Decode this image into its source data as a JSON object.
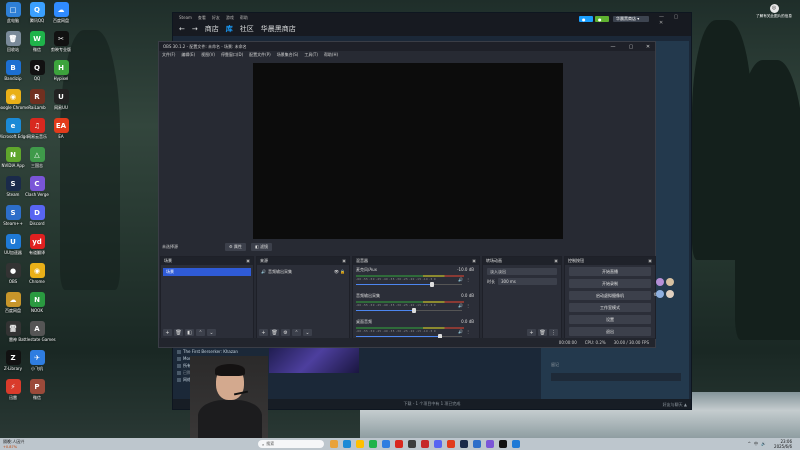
{
  "desktop": {
    "icons": [
      {
        "label": "此电脑",
        "color": "#2e7fd6",
        "glyph": "□"
      },
      {
        "label": "腾讯QQ",
        "color": "#3aa0ff",
        "glyph": "Q"
      },
      {
        "label": "百度网盘",
        "color": "#2f8bff",
        "glyph": "☁"
      },
      {
        "label": "回收站",
        "color": "#7a8a99",
        "glyph": "🗑"
      },
      {
        "label": "微信",
        "color": "#1fb34a",
        "glyph": "W"
      },
      {
        "label": "剪映专业版",
        "color": "#111111",
        "glyph": "✂"
      },
      {
        "label": "Bandizip",
        "color": "#1d6fd1",
        "glyph": "B"
      },
      {
        "label": "QQ",
        "color": "#111111",
        "glyph": "Q"
      },
      {
        "label": "Hypixel",
        "color": "#3ca33c",
        "glyph": "H"
      },
      {
        "label": "Google Chrome",
        "color": "#e9b018",
        "glyph": "◉"
      },
      {
        "label": "RaiLamb",
        "color": "#703020",
        "glyph": "R"
      },
      {
        "label": "网易UU",
        "color": "#222222",
        "glyph": "U"
      },
      {
        "label": "Microsoft Edge",
        "color": "#1b8ad6",
        "glyph": "e"
      },
      {
        "label": "网易云音乐",
        "color": "#d8281f",
        "glyph": "♫"
      },
      {
        "label": "EA",
        "color": "#e23b1b",
        "glyph": "EA"
      },
      {
        "label": "NVIDIA App",
        "color": "#5fa62c",
        "glyph": "N"
      },
      {
        "label": "三国志",
        "color": "#3f9a4a",
        "glyph": "△"
      },
      {
        "label": "",
        "color": "transparent",
        "glyph": ""
      },
      {
        "label": "Steam",
        "color": "#1a2a4a",
        "glyph": "S"
      },
      {
        "label": "Clash Verge",
        "color": "#7a55d8",
        "glyph": "C"
      },
      {
        "label": "",
        "color": "transparent",
        "glyph": ""
      },
      {
        "label": "Steam++",
        "color": "#2d6ec9",
        "glyph": "S"
      },
      {
        "label": "Discord",
        "color": "#5865f2",
        "glyph": "D"
      },
      {
        "label": "",
        "color": "transparent",
        "glyph": ""
      },
      {
        "label": "UU加速器",
        "color": "#1f7ad6",
        "glyph": "U"
      },
      {
        "label": "有道翻译",
        "color": "#e02020",
        "glyph": "yd"
      },
      {
        "label": "",
        "color": "transparent",
        "glyph": ""
      },
      {
        "label": "OBS",
        "color": "#333333",
        "glyph": "●"
      },
      {
        "label": "Chrome",
        "color": "#e9b018",
        "glyph": "◉"
      },
      {
        "label": "",
        "color": "transparent",
        "glyph": ""
      },
      {
        "label": "百度网盘",
        "color": "#c7952a",
        "glyph": "☁"
      },
      {
        "label": "NOOK",
        "color": "#2a9a40",
        "glyph": "N"
      },
      {
        "label": "",
        "color": "transparent",
        "glyph": ""
      },
      {
        "label": "雷神",
        "color": "#333333",
        "glyph": "雷"
      },
      {
        "label": "Battlestate Games",
        "color": "#555555",
        "glyph": "A"
      },
      {
        "label": "",
        "color": "transparent",
        "glyph": ""
      },
      {
        "label": "Z-Library",
        "color": "#111111",
        "glyph": "Z"
      },
      {
        "label": "小飞机",
        "color": "#2f7de0",
        "glyph": "✈"
      },
      {
        "label": "",
        "color": "transparent",
        "glyph": ""
      },
      {
        "label": "迅雷",
        "color": "#d93b2b",
        "glyph": "⚡"
      },
      {
        "label": "微信",
        "color": "#9b4a3a",
        "glyph": "P"
      }
    ]
  },
  "steam": {
    "top_menu": [
      "Steam",
      "查看",
      "好友",
      "游戏",
      "帮助"
    ],
    "nav": {
      "store": "商店",
      "library": "库",
      "community": "社区",
      "user": "华晨黑商店"
    },
    "buttons": [
      {
        "label": "●",
        "color": "#1a9fff"
      },
      {
        "label": "●",
        "color": "#5fb130"
      }
    ],
    "user": "华晨黑商店 ▾",
    "library_list": [
      {
        "label": "全部",
        "color": "#8f98a0"
      },
      {
        "label": "The First Berserker: Khazan",
        "color": "#c6d4df"
      },
      {
        "label": "Monster Hunter Wilds",
        "color": "#c6d4df"
      },
      {
        "label": "所有游戏",
        "color": "#c6d4df"
      },
      {
        "label": "已购",
        "color": "#8f98a0"
      },
      {
        "label": "网络浏览",
        "color": "#c6d4df"
      }
    ],
    "downloads": "下载 - 1 个项目中有 1 项已完成",
    "friends": "好友与聊天 ▲",
    "right_panel": {
      "label_a": "看过",
      "label_b": "留记"
    }
  },
  "obs": {
    "title": "OBS 30.1.2 - 配置文件: 未命名 - 场景: 未命名",
    "menu": [
      "文件(F)",
      "编辑(E)",
      "视图(V)",
      "停靠窗口(D)",
      "配置文件(P)",
      "场景集合(S)",
      "工具(T)",
      "帮助(H)"
    ],
    "strip": {
      "no_source": "未选择源",
      "props": "⚙ 属性",
      "filters": "◧ 滤镜"
    },
    "scenes": {
      "title": "场景",
      "items": [
        "场景"
      ]
    },
    "sources": {
      "title": "来源",
      "items": [
        {
          "icon": "🔊",
          "label": "音频输出采集"
        }
      ]
    },
    "mixer": {
      "title": "混音器",
      "channels": [
        {
          "name": "麦克风/Aux",
          "db": "-10.0 dB",
          "level": 0.72
        },
        {
          "name": "音频输出采集",
          "db": "0.0 dB",
          "level": 0.55
        },
        {
          "name": "桌面音频",
          "db": "0.0 dB",
          "level": 0.8
        }
      ],
      "ticks": "-60 -55 -50 -45 -40 -35 -30 -25 -20 -15 -10 -5 0"
    },
    "transitions": {
      "title": "转场动画",
      "type": "淡入淡出",
      "duration_label": "时长",
      "duration": "300 ms"
    },
    "controls": {
      "title": "控制按钮",
      "buttons": [
        "开始直播",
        "开始录制",
        "启动虚拟摄像机",
        "工作室模式",
        "设置",
        "退出"
      ]
    },
    "footer": {
      "cpu": "CPU: 0.2%",
      "fps": "30.00 / 30.00 FPS",
      "time": "00:00:00"
    }
  },
  "taskbar": {
    "weather": "隔晚:人因兴",
    "weather_sub": "+0.87%",
    "search_placeholder": "搜索",
    "time": "23:06",
    "date": "2025/6/6",
    "tray": [
      "^",
      "中",
      "🔊"
    ],
    "apps": [
      {
        "color": "#e9a23b"
      },
      {
        "color": "#1b8ad6"
      },
      {
        "color": "#ffbf00"
      },
      {
        "color": "#1fb34a"
      },
      {
        "color": "#2f7de0"
      },
      {
        "color": "#d8281f"
      },
      {
        "color": "#3c3c3c"
      },
      {
        "color": "#c62828"
      },
      {
        "color": "#5865f2"
      },
      {
        "color": "#e23b1b"
      },
      {
        "color": "#1a2a4a"
      },
      {
        "color": "#2d6ec9"
      },
      {
        "color": "#7a55d8"
      },
      {
        "color": "#111111"
      },
      {
        "color": "#1f7ad6"
      }
    ]
  },
  "clock_widget": {
    "label": "了解有关此图片的信息"
  }
}
